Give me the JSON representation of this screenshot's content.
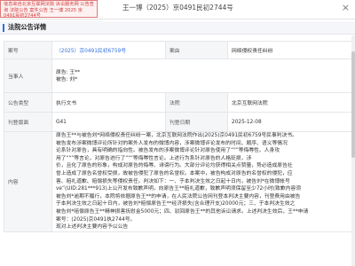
{
  "header": {
    "stamp_text": "信息来自北京互联网法院 诉讼服务网 公告查询 法院公告 案件公告 王一博 2025 京0491民初2744号",
    "case_title": "王一博（2025）京0491民初2744号",
    "close_symbol": "×"
  },
  "section": {
    "title": "法院公告详情"
  },
  "rows": {
    "case_no_label": "案号",
    "case_no_value": "（2025）京0491民初6759号",
    "cause_label": "案由",
    "cause_value": "网络侵权责任纠纷",
    "parties_label": "当事人",
    "plaintiff_label": "原告:",
    "plaintiff_value": "王**",
    "defendant_label": "被告:",
    "defendant_value": "刘*",
    "type_label": "公告类型",
    "type_value": "执行文书",
    "court_label": "法院",
    "court_value": "北京互联网法院",
    "venue_label": "刊登版面",
    "venue_value": "G41",
    "date_label": "刊登日期",
    "date_value": "2025-12-08",
    "content_label": "内容",
    "content_lines": [
      "原告王**与被告刘*网络侵权责任纠纷一案，北京互联网法院作出(2025)京0491民初6759号民事判决书。",
      "被告发布涉案微博评论所针对的案外人发布的微博内容，涉案微博评论发布的时间、顺序、语义等情况",
      "论系针对原告，具有明确的指向性。被告发布的涉案微博评论针对原告使用了“\"”等侮辱性、人身攻",
      "用了“\"”等言论，对原告进行了“\"”等侮辱性言论。上述行为系针对原告的人格贬损，涉",
      "价，且化了原告的形象，构成对原告的侮辱、诽谤行为。大部分评论均获得相关点赞量，势必造成原告社",
      "誉上造成了原告名誉权受损，故被告侵犯了原告的名誉权。本案中，被告构成对原告的名誉权的侵犯，应",
      "害、赔礼道歉、赔偿损失等侵权责任。判决如下：一、于本判决生效之日起十日内，被告刘*在微博帐号",
      "ve”(UID:281***913)上公开发布致歉声明，向原告王**赔礼道歉，致歉声明须保留至少72小时(致歉内容须",
      "被告刘*逾期不履行，本院将依据原告王**的申请，在人民法院公告网刊登本判决主要内容，刊登费用由被告",
      "于本判决生效之日起十日内，被告刘*赔偿原告王**经济损失(含合理开支)20000元；三、于本判决生效之",
      "被告刘*赔偿原告王**精神损害抚慰金5000元；四、驳回原告王**的其他诉讼请求。上述判决生效后，王**申请",
      "案号：(2025)京0491执2744号。",
      "现对上述判决主要内容予以公告"
    ]
  }
}
